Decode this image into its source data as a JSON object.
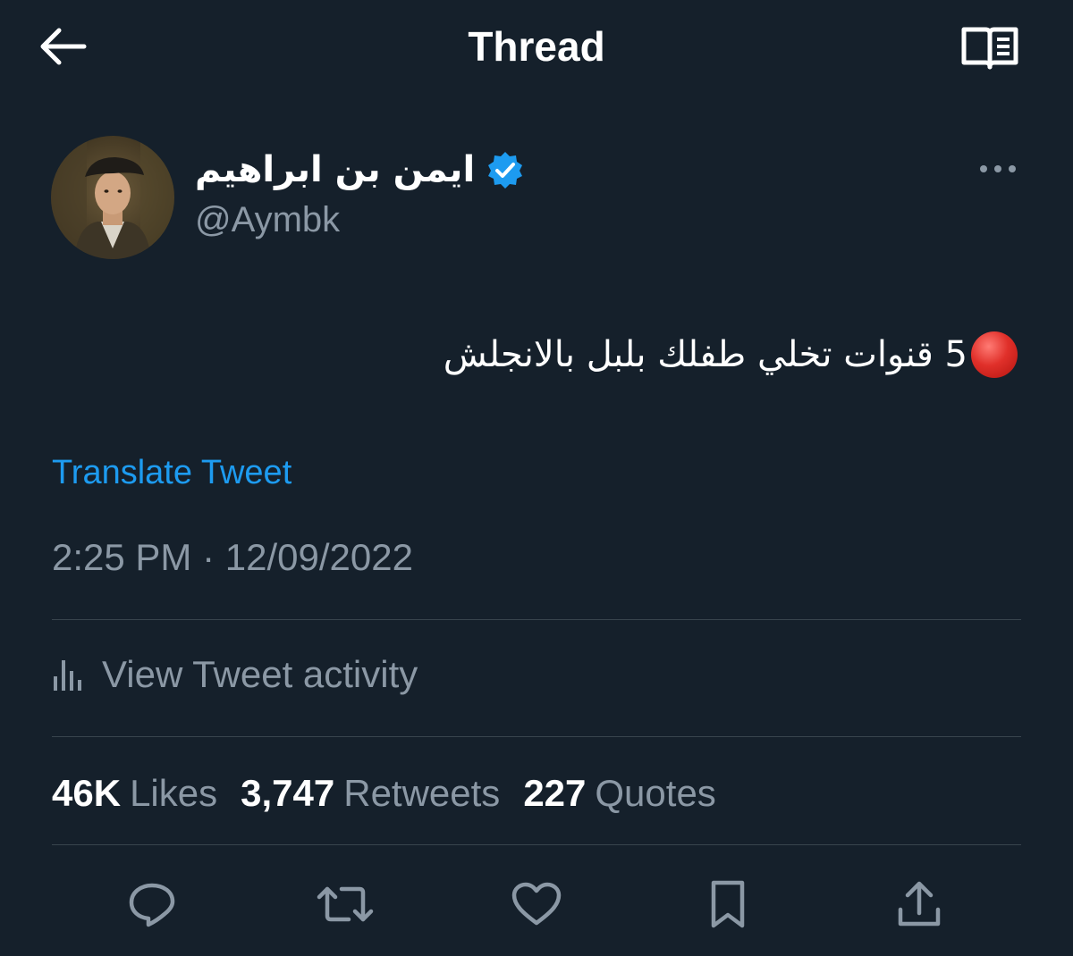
{
  "header": {
    "title": "Thread",
    "back_icon": "arrow-left-icon",
    "reader_icon": "book-open-icon"
  },
  "author": {
    "name": "ايمن بن ابراهيم",
    "handle": "@Aymbk",
    "verified": true,
    "verified_color": "#1d9bf0"
  },
  "tweet": {
    "emoji": "red-circle",
    "text": "5 قنوات تخلي طفلك بلبل بالانجلش",
    "translate_label": "Translate Tweet",
    "timestamp": "2:25 PM · 12/09/2022"
  },
  "activity": {
    "label": "View Tweet activity",
    "icon": "bar-chart-icon"
  },
  "stats": {
    "likes_count": "46K",
    "likes_label": "Likes",
    "retweets_count": "3,747",
    "retweets_label": "Retweets",
    "quotes_count": "227",
    "quotes_label": "Quotes"
  },
  "actions": [
    "reply-icon",
    "retweet-icon",
    "like-icon",
    "bookmark-icon",
    "share-icon"
  ],
  "colors": {
    "background": "#15202b",
    "secondary_text": "#8b98a5",
    "accent": "#1d9bf0",
    "divider": "#38444d"
  }
}
